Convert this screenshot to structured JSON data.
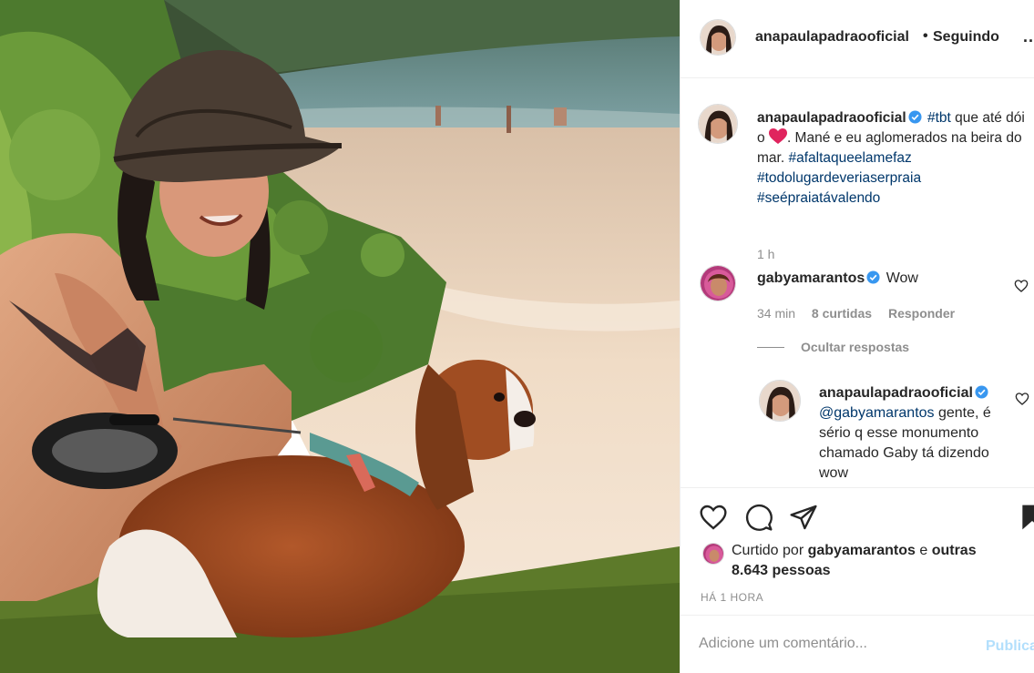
{
  "post": {
    "author": "anapaulapadraooficial",
    "follow_dot": "•",
    "follow_status": "Seguindo",
    "more_label": "..."
  },
  "caption": {
    "username": "anapaulapadraooficial",
    "tag_tbt": "#tbt",
    "text_a": "que até dói o",
    "text_b": ". Mané e eu aglomerados na beira do mar.",
    "tag_1": "#afaltaqueelamefaz",
    "tag_2": "#todolugardeveriaserpraia",
    "tag_3": "#seépraiatávalendo",
    "time": "1 h"
  },
  "comment": {
    "username": "gabyamarantos",
    "text": "Wow",
    "time": "34 min",
    "likes": "8 curtidas",
    "reply": "Responder"
  },
  "hide_replies": "Ocultar respostas",
  "reply": {
    "username": "anapaulapadraooficial",
    "mention": "@gabyamarantos",
    "text": "gente, é sério q esse monumento chamado Gaby tá dizendo wow"
  },
  "likes": {
    "prefix": "Curtido por",
    "user": "gabyamarantos",
    "conj": "e",
    "others": "outras 8.643 pessoas"
  },
  "posted_time": "HÁ 1 HORA",
  "add_comment": {
    "placeholder": "Adicione um comentário...",
    "publish": "Publicar"
  },
  "colors": {
    "verified": "#3897f0",
    "link": "#00376b",
    "muted": "#8e8e8e",
    "heart_emoji": "#e0245e"
  }
}
